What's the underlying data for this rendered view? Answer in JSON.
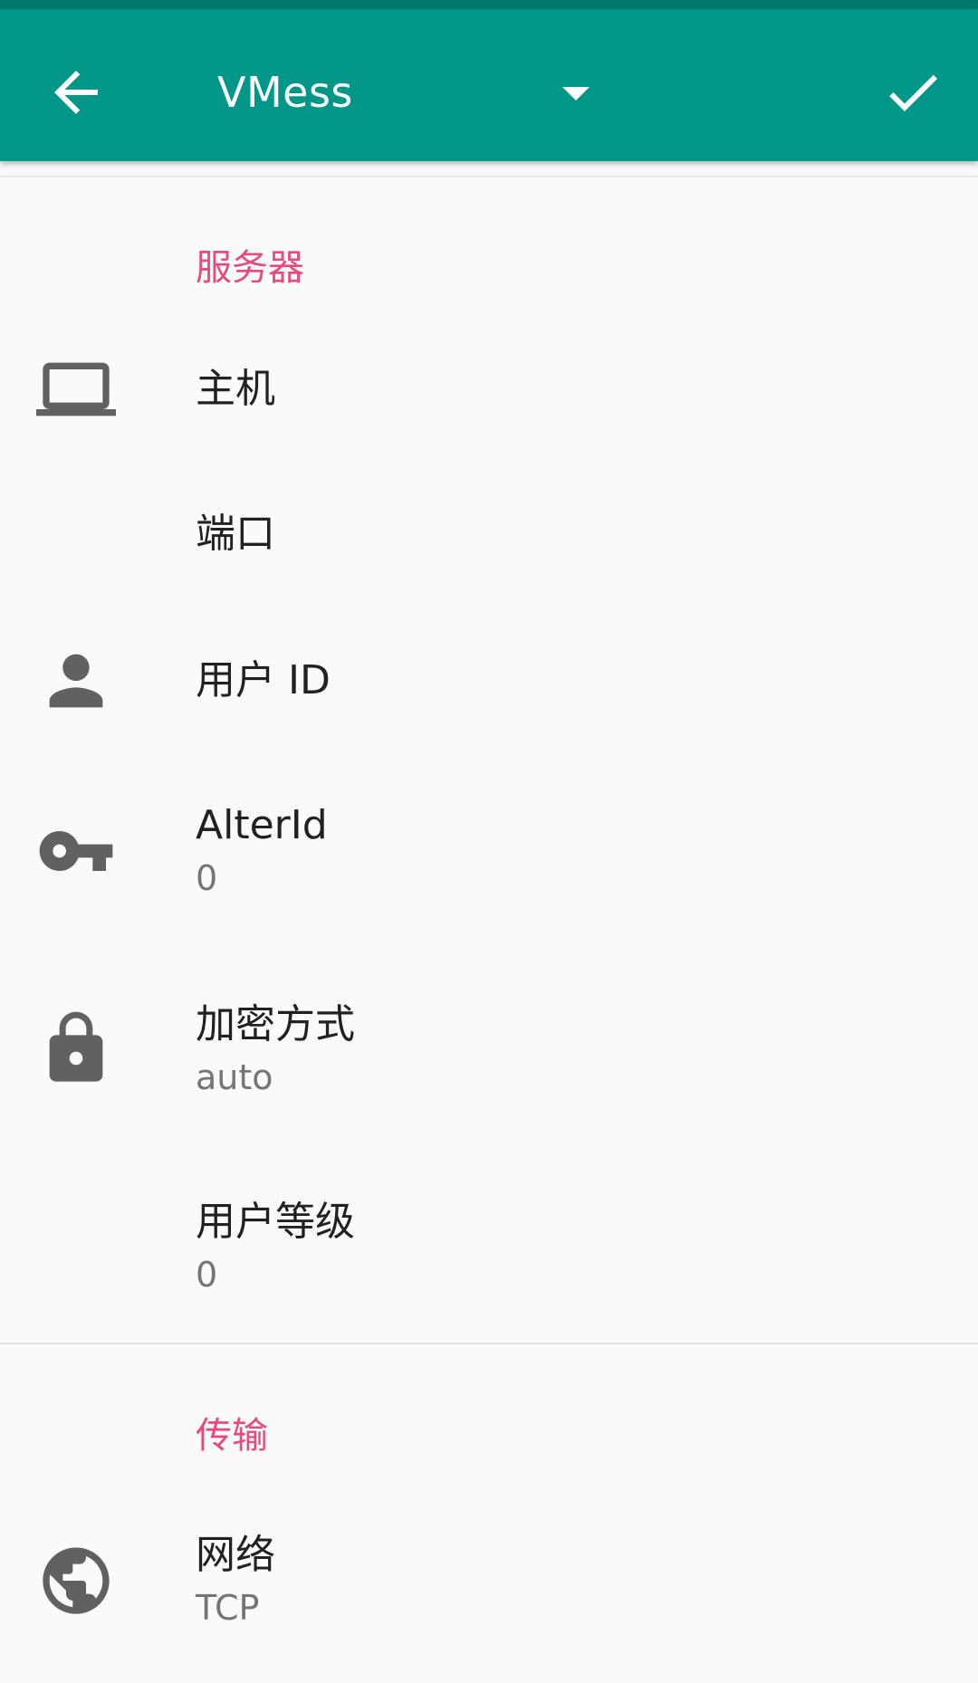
{
  "toolbar": {
    "title": "VMess",
    "background_color": "#009688",
    "back_icon": "arrow-back-icon",
    "dropdown_icon": "arrow-drop-down-icon",
    "confirm_icon": "check-icon"
  },
  "colors": {
    "accent": "#e64a7f",
    "primary": "#009688",
    "primary_dark": "#00796b",
    "background": "#fafafa",
    "icon": "#616161"
  },
  "sections": [
    {
      "header": "服务器",
      "items": [
        {
          "title": "主机",
          "summary": "",
          "icon": "laptop-icon"
        },
        {
          "title": "端口",
          "summary": "",
          "icon": ""
        },
        {
          "title": "用户 ID",
          "summary": "",
          "icon": "person-icon"
        },
        {
          "title": "AlterId",
          "summary": "0",
          "icon": "key-icon"
        },
        {
          "title": "加密方式",
          "summary": "auto",
          "icon": "lock-icon"
        },
        {
          "title": "用户等级",
          "summary": "0",
          "icon": ""
        }
      ]
    },
    {
      "header": "传输",
      "items": [
        {
          "title": "网络",
          "summary": "TCP",
          "icon": "globe-icon"
        }
      ]
    }
  ]
}
